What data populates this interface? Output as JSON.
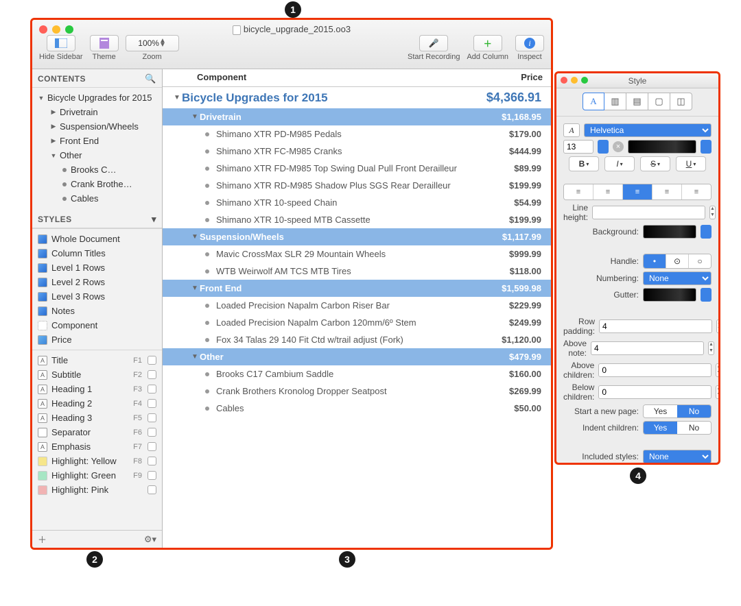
{
  "callouts": {
    "1": "1",
    "2": "2",
    "3": "3",
    "4": "4"
  },
  "window": {
    "title": "bicycle_upgrade_2015.oo3",
    "toolbar": {
      "hide_sidebar": "Hide Sidebar",
      "theme": "Theme",
      "zoom_label": "Zoom",
      "zoom_value": "100%",
      "start_recording": "Start Recording",
      "add_column": "Add Column",
      "inspect": "Inspect"
    }
  },
  "sidebar": {
    "contents_header": "CONTENTS",
    "tree": {
      "root": "Bicycle Upgrades for 2015",
      "items": [
        {
          "label": "Drivetrain"
        },
        {
          "label": "Suspension/Wheels"
        },
        {
          "label": "Front End"
        },
        {
          "label": "Other",
          "expanded": true,
          "children": [
            {
              "label": "Brooks C…"
            },
            {
              "label": "Crank Brothe…"
            },
            {
              "label": "Cables"
            }
          ]
        }
      ]
    },
    "styles_header": "STYLES",
    "styles": [
      "Whole Document",
      "Column Titles",
      "Level 1 Rows",
      "Level 2 Rows",
      "Level 3 Rows",
      "Notes",
      "Component",
      "Price"
    ],
    "fn_styles": [
      {
        "label": "Title",
        "key": "F1",
        "sw": "A"
      },
      {
        "label": "Subtitle",
        "key": "F2",
        "sw": "A"
      },
      {
        "label": "Heading 1",
        "key": "F3",
        "sw": "A"
      },
      {
        "label": "Heading 2",
        "key": "F4",
        "sw": "A"
      },
      {
        "label": "Heading 3",
        "key": "F5",
        "sw": "A"
      },
      {
        "label": "Separator",
        "key": "F6",
        "sw": ""
      },
      {
        "label": "Emphasis",
        "key": "F7",
        "sw": "A"
      },
      {
        "label": "Highlight: Yellow",
        "key": "F8",
        "color": "#f6e68a"
      },
      {
        "label": "Highlight: Green",
        "key": "F9",
        "color": "#a7e6c4"
      },
      {
        "label": "Highlight: Pink",
        "key": "",
        "color": "#f1b3b3"
      }
    ]
  },
  "outline": {
    "col_left": "Component",
    "col_right": "Price",
    "root": {
      "label": "Bicycle Upgrades for 2015",
      "price": "$4,366.91"
    },
    "groups": [
      {
        "label": "Drivetrain",
        "price": "$1,168.95",
        "items": [
          {
            "label": "Shimano XTR PD-M985 Pedals",
            "price": "$179.00"
          },
          {
            "label": "Shimano XTR FC-M985 Cranks",
            "price": "$444.99"
          },
          {
            "label": "Shimano XTR FD-M985 Top Swing Dual Pull Front Derailleur",
            "price": "$89.99"
          },
          {
            "label": "Shimano XTR RD-M985 Shadow Plus SGS Rear Derailleur",
            "price": "$199.99"
          },
          {
            "label": "Shimano XTR 10-speed Chain",
            "price": "$54.99"
          },
          {
            "label": "Shimano XTR 10-speed MTB Cassette",
            "price": "$199.99"
          }
        ]
      },
      {
        "label": "Suspension/Wheels",
        "price": "$1,117.99",
        "items": [
          {
            "label": "Mavic CrossMax SLR 29 Mountain Wheels",
            "price": "$999.99"
          },
          {
            "label": "WTB Weirwolf AM TCS MTB Tires",
            "price": "$118.00"
          }
        ]
      },
      {
        "label": "Front End",
        "price": "$1,599.98",
        "items": [
          {
            "label": "Loaded Precision Napalm Carbon Riser Bar",
            "price": "$229.99"
          },
          {
            "label": "Loaded Precision Napalm Carbon 120mm/6º Stem",
            "price": "$249.99"
          },
          {
            "label": "Fox 34 Talas 29 140 Fit Ctd w/trail adjust (Fork)",
            "price": "$1,120.00"
          }
        ]
      },
      {
        "label": "Other",
        "price": "$479.99",
        "items": [
          {
            "label": "Brooks C17 Cambium Saddle",
            "price": "$160.00"
          },
          {
            "label": "Crank Brothers Kronolog Dropper Seatpost",
            "price": "$269.99"
          },
          {
            "label": "Cables",
            "price": "$50.00"
          }
        ]
      }
    ]
  },
  "inspector": {
    "title": "Style",
    "font_name": "Helvetica",
    "font_size": "13",
    "line_height_label": "Line height:",
    "background_label": "Background:",
    "handle_label": "Handle:",
    "numbering_label": "Numbering:",
    "numbering_value": "None",
    "gutter_label": "Gutter:",
    "row_padding_label": "Row padding:",
    "row_padding_value": "4",
    "above_note_label": "Above note:",
    "above_note_value": "4",
    "above_children_label": "Above children:",
    "above_children_value": "0",
    "below_children_label": "Below children:",
    "below_children_value": "0",
    "start_new_page_label": "Start a new page:",
    "indent_children_label": "Indent children:",
    "included_styles_label": "Included styles:",
    "included_styles_value": "None",
    "yes": "Yes",
    "no": "No",
    "b": "B",
    "i": "I",
    "s": "S",
    "u": "U"
  }
}
